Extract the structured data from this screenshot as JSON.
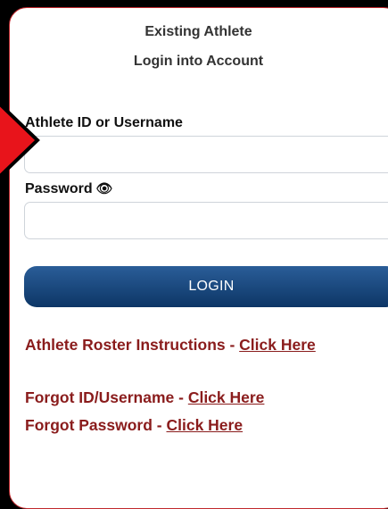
{
  "header": {
    "line1": "Existing Athlete",
    "line2": "Login into Account"
  },
  "form": {
    "username_label": "Athlete ID or Username",
    "username_value": "",
    "password_label": "Password",
    "password_value": "",
    "eye_icon": "👁",
    "login_label": "LOGIN"
  },
  "links": {
    "roster_text": "Athlete Roster Instructions - ",
    "roster_link": "Click Here",
    "forgot_id_text": "Forgot ID/Username - ",
    "forgot_id_link": "Click Here",
    "forgot_pass_text": "Forgot Password - ",
    "forgot_pass_link": "Click Here"
  },
  "colors": {
    "card_border": "#c0282d",
    "button": "#0d3666",
    "link": "#8a1c1c",
    "arrow_fill": "#e8141b"
  }
}
